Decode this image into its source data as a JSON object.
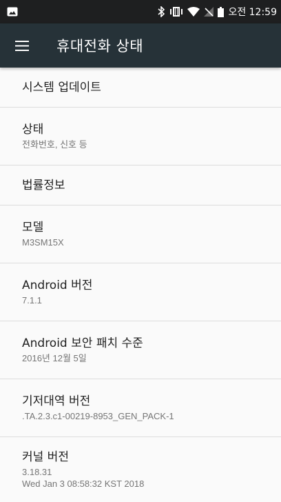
{
  "status_bar": {
    "time": "오전 12:59",
    "icons": [
      "image-notification-icon",
      "bluetooth-icon",
      "vibrate-icon",
      "wifi-icon",
      "no-sim-icon",
      "battery-icon"
    ]
  },
  "app_bar": {
    "title": "휴대전화 상태",
    "menu_icon": "hamburger-menu-icon"
  },
  "items": [
    {
      "title": "시스템 업데이트"
    },
    {
      "title": "상태",
      "summary": "전화번호, 신호 등"
    },
    {
      "title": "법률정보"
    },
    {
      "title": "모델",
      "summary": "M3SM15X"
    },
    {
      "title": "Android 버전",
      "summary": "7.1.1"
    },
    {
      "title": "Android 보안 패치 수준",
      "summary": "2016년 12월 5일"
    },
    {
      "title": "기저대역 버전",
      "summary": ".TA.2.3.c1-00219-8953_GEN_PACK-1"
    },
    {
      "title": "커널 버전",
      "summary": "3.18.31",
      "summary2": "Wed Jan 3 08:58:32 KST 2018"
    }
  ],
  "colors": {
    "status_bar": "#1e1f20",
    "app_bar": "#263238",
    "background": "#fafafa",
    "divider": "#dcdcdc",
    "summary_text": "#757575"
  }
}
